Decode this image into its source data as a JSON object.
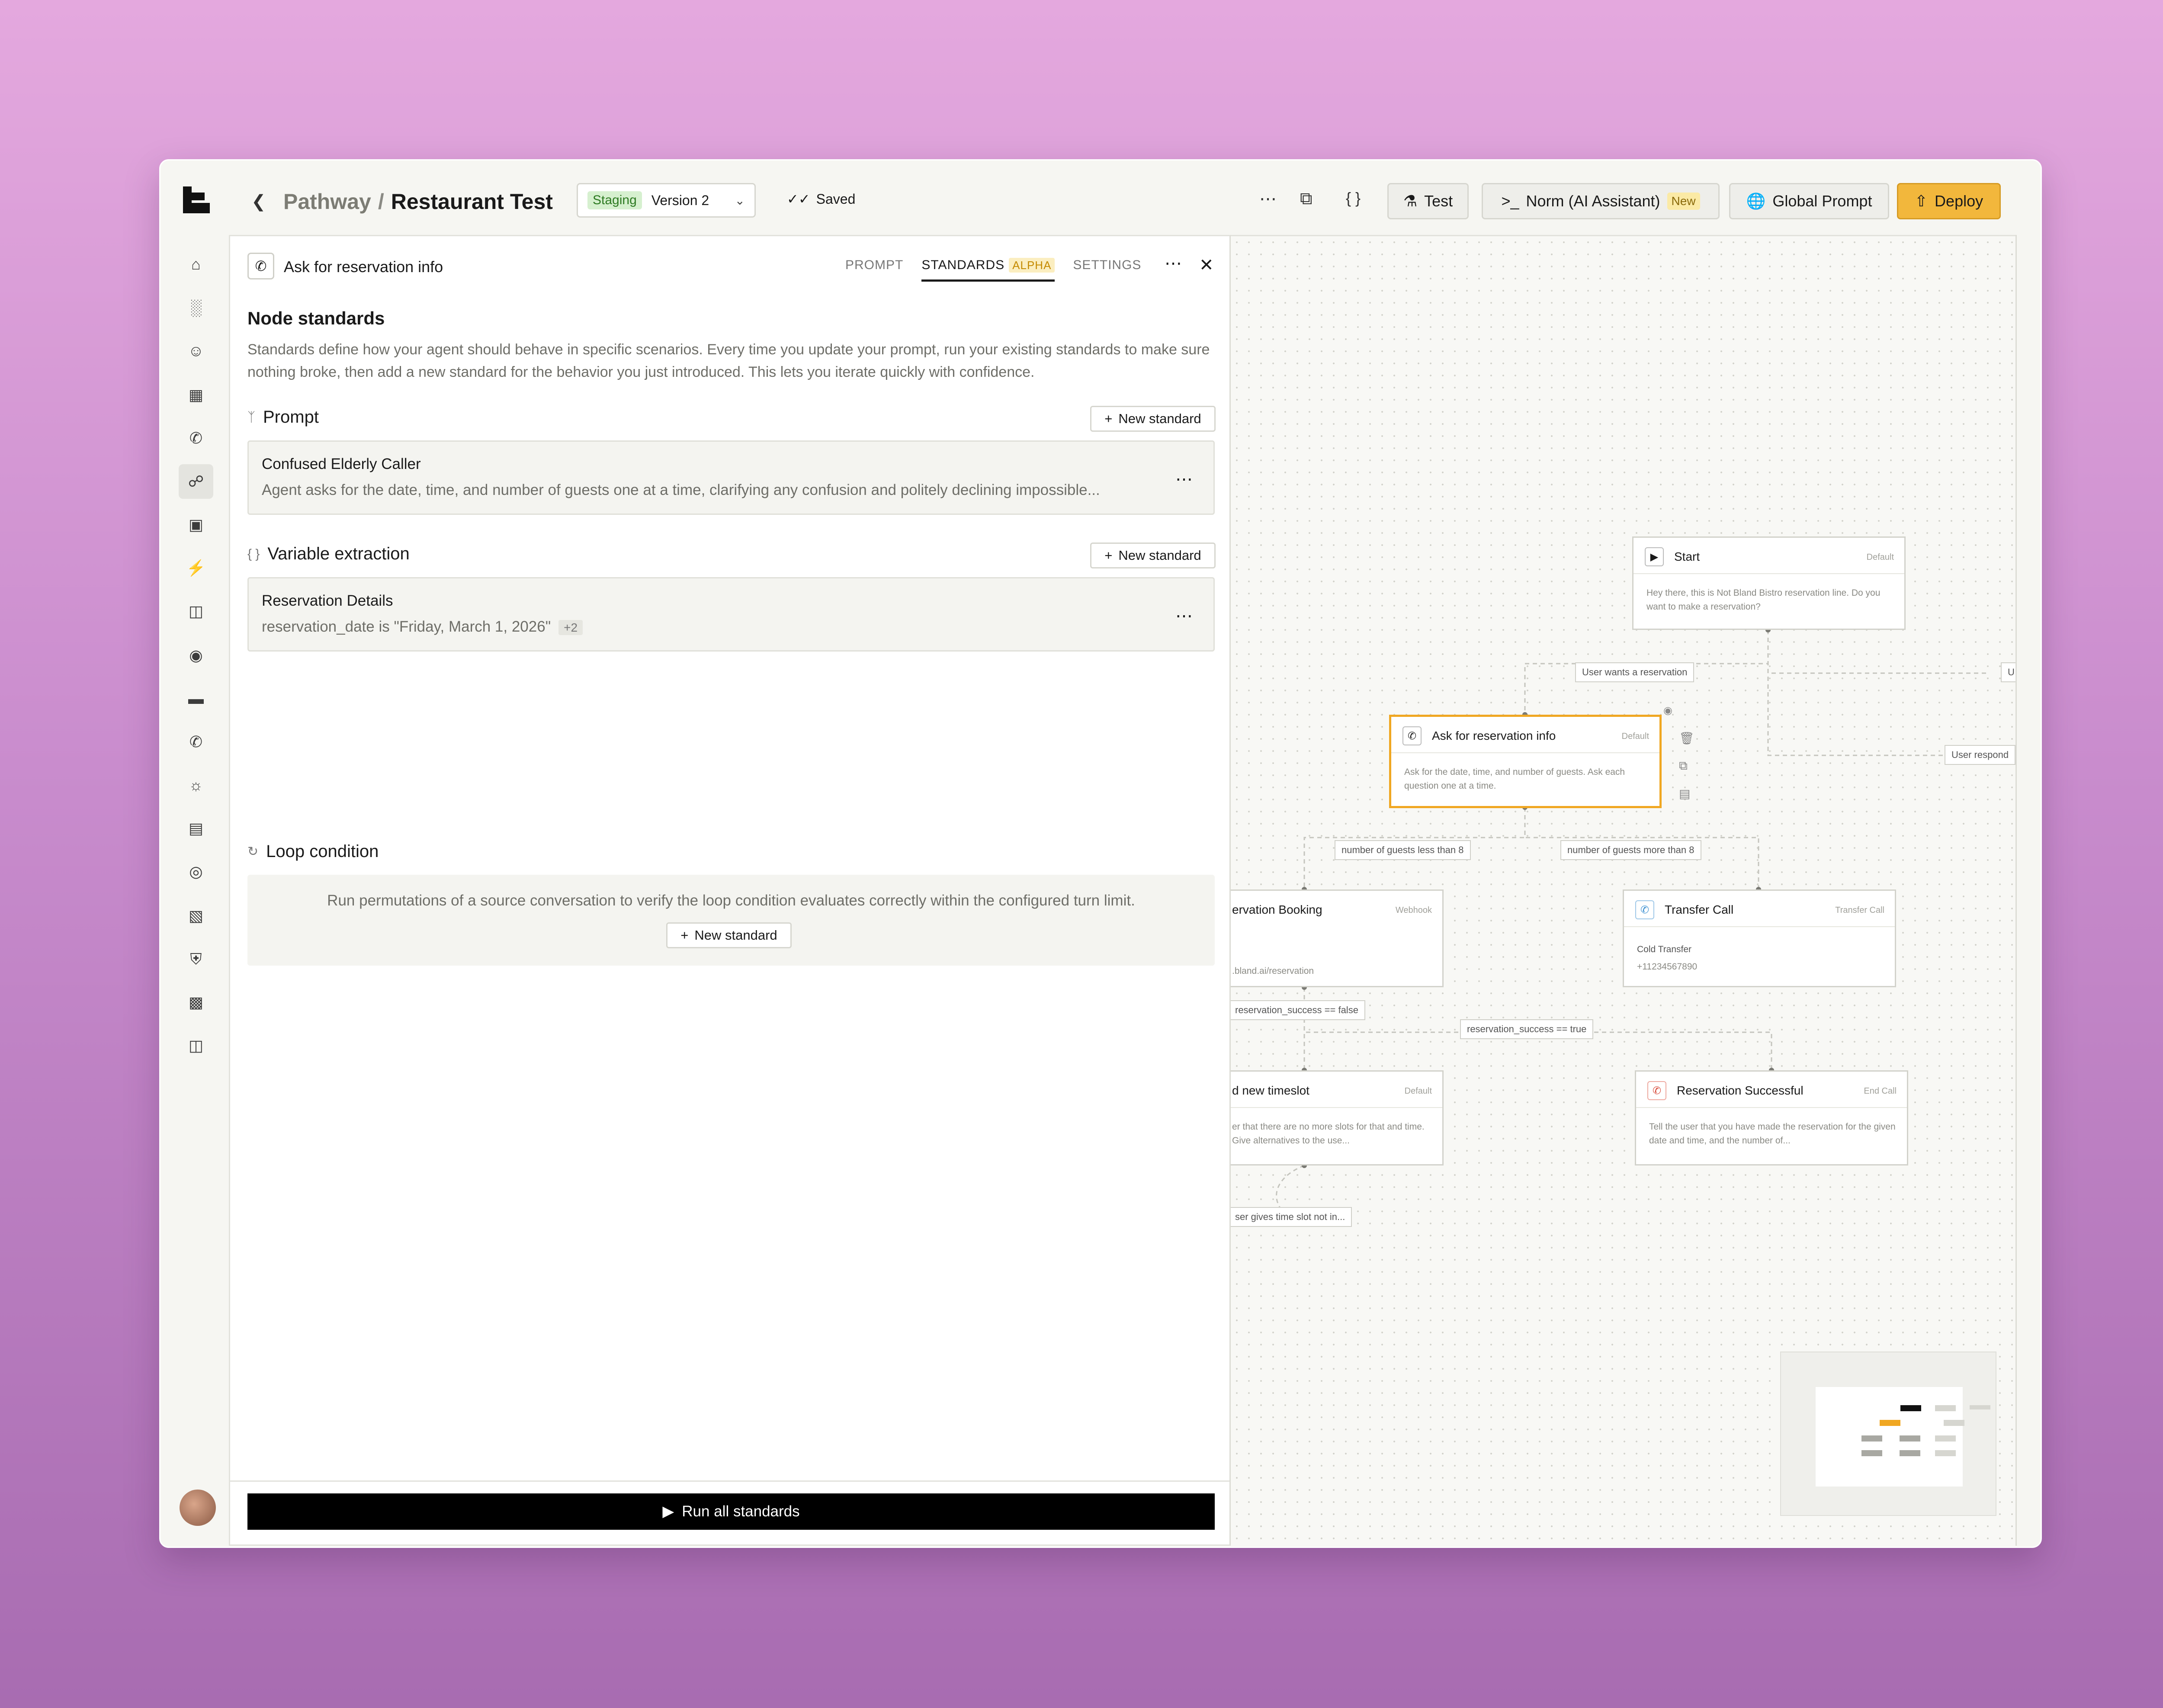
{
  "header": {
    "breadcrumb_parent": "Pathway",
    "breadcrumb_sep": "/",
    "breadcrumb_current": "Restaurant Test",
    "env_badge": "Staging",
    "version": "Version 2",
    "saved_label": "Saved",
    "test_label": "Test",
    "norm_label": "Norm (AI Assistant)",
    "norm_badge": "New",
    "global_prompt_label": "Global Prompt",
    "deploy_label": "Deploy"
  },
  "panel": {
    "node_title": "Ask for reservation info",
    "tabs": [
      {
        "label": "PROMPT",
        "active": false
      },
      {
        "label": "STANDARDS",
        "active": true,
        "badge": "ALPHA"
      },
      {
        "label": "SETTINGS",
        "active": false
      }
    ],
    "section_title": "Node standards",
    "description": "Standards define how your agent should behave in specific scenarios. Every time you update your prompt, run your existing standards to make sure nothing broke, then add a new standard for the behavior you just introduced. This lets you iterate quickly with confidence.",
    "new_standard_label": "New standard",
    "groups": {
      "prompt": {
        "title": "Prompt",
        "card_title": "Confused Elderly Caller",
        "card_sub": "Agent asks for the date, time, and number of guests one at a time, clarifying any confusion and politely declining impossible..."
      },
      "variable": {
        "title": "Variable extraction",
        "card_title": "Reservation Details",
        "card_sub": "reservation_date is \"Friday, March 1, 2026\"",
        "card_badge": "+2"
      },
      "loop": {
        "title": "Loop condition",
        "text": "Run permutations of a source conversation to verify the loop condition evaluates correctly within the configured turn limit."
      }
    },
    "run_all_label": "Run all standards"
  },
  "canvas": {
    "nodes": {
      "start": {
        "title": "Start",
        "type": "Default",
        "body": "Hey there, this is Not Bland Bistro reservation line. Do you want to make a reservation?"
      },
      "ask": {
        "title": "Ask for reservation info",
        "type": "Default",
        "body": "Ask for the date, time, and number of guests. Ask each question one at a time."
      },
      "booking": {
        "title": "ervation Booking",
        "type": "Webhook",
        "body": ".bland.ai/reservation"
      },
      "transfer": {
        "title": "Transfer Call",
        "type": "Transfer Call",
        "body_line1": "Cold Transfer",
        "body_line2": "+11234567890"
      },
      "timeslot": {
        "title": "d new timeslot",
        "type": "Default",
        "body": "er that there are no more slots for that and time. Give alternatives to the use..."
      },
      "success": {
        "title": "Reservation Successful",
        "type": "End Call",
        "body": "Tell the user that you have made the reservation for the given date and time, and the number of..."
      }
    },
    "edges": {
      "wants_reservation": "User wants a reservation",
      "user_responds": "User respond",
      "u_cut": "U",
      "less_than_8": "number of guests less than 8",
      "more_than_8": "number of guests more than 8",
      "success_false": "reservation_success == false",
      "success_true": "reservation_success == true",
      "gives_time_slot": "ser gives time slot not in..."
    }
  },
  "colors": {
    "accent": "#f0a722",
    "deploy": "#f2b73c",
    "staging_bg": "#d6f0cf",
    "staging_fg": "#2d7a22"
  }
}
